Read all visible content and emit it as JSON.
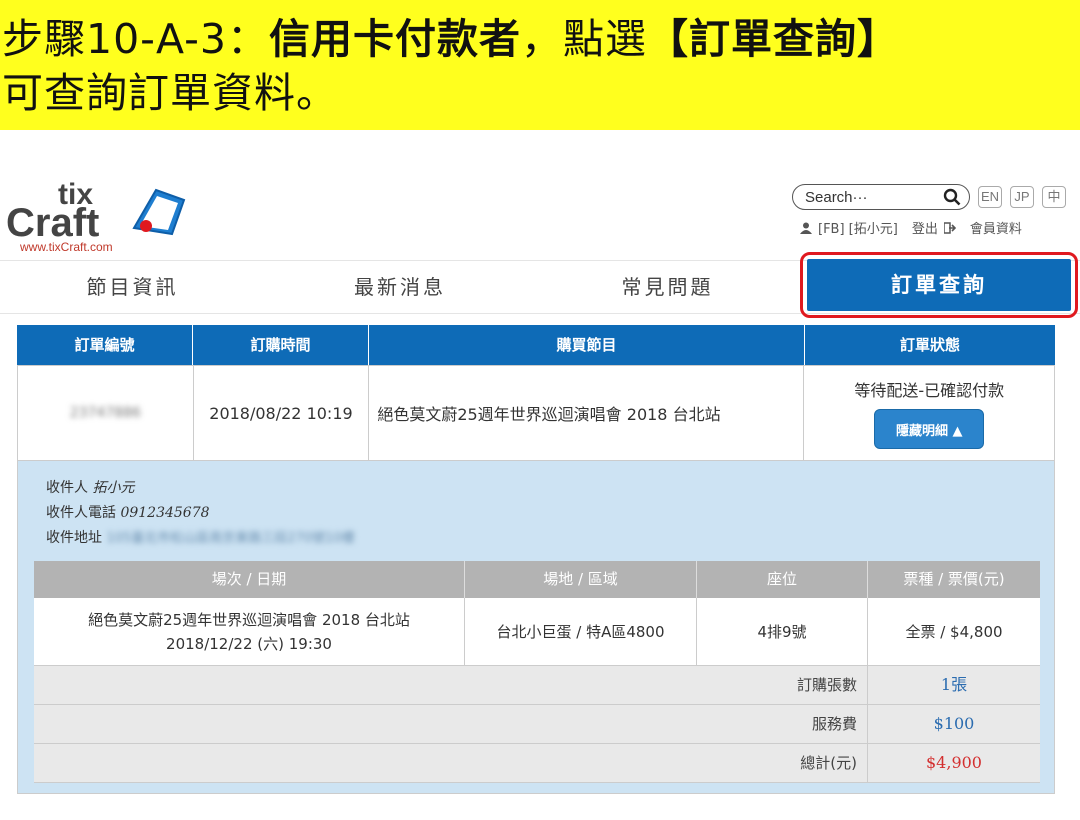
{
  "banner": {
    "line1_prefix": "步驟10-A-3：",
    "line1_bold": "信用卡付款者",
    "line1_mid": "，點選",
    "line1_bold2": "【訂單查詢】",
    "line2": "可查詢訂單資料。"
  },
  "header": {
    "logo_top": "tix",
    "logo_bottom": "Craft",
    "logo_url": "www.tixCraft.com",
    "search_placeholder": "Search···",
    "lang": [
      "EN",
      "JP",
      "中"
    ],
    "user": "[FB] [拓小元]",
    "logout": "登出",
    "member": "會員資料"
  },
  "nav": {
    "items": [
      "節目資訊",
      "最新消息",
      "常見問題"
    ],
    "active": "訂單查詢"
  },
  "order_table": {
    "headers": [
      "訂單編號",
      "訂購時間",
      "購買節目",
      "訂單狀態"
    ],
    "order_no": "23747886",
    "time": "2018/08/22 10:19",
    "event": "絕色莫文蔚25週年世界巡迴演唱會 2018 台北站",
    "status": "等待配送-已確認付款",
    "hide_btn": "隱藏明細 ▲"
  },
  "recipient": {
    "name_label": "收件人",
    "name": "拓小元",
    "phone_label": "收件人電話",
    "phone": "0912345678",
    "addr_label": "收件地址",
    "addr": "105臺北市松山區南京東路三段270號10樓"
  },
  "detail_table": {
    "headers": [
      "場次 / 日期",
      "場地 / 區域",
      "座位",
      "票種 / 票價(元)"
    ],
    "row": {
      "event": "絕色莫文蔚25週年世界巡迴演唱會 2018 台北站",
      "date": "2018/12/22 (六) 19:30",
      "venue": "台北小巨蛋 / 特A區4800",
      "seat": "4排9號",
      "ticket": "全票 / $4,800"
    },
    "summary": [
      {
        "label": "訂購張數",
        "value": "1張"
      },
      {
        "label": "服務費",
        "value": "$100"
      },
      {
        "label": "總計(元)",
        "value": "$4,900"
      }
    ]
  },
  "colors": {
    "banner": "#ffff1e",
    "primary": "#0e6bb7",
    "highlight_border": "#e0191f",
    "sum_blue": "#2b6cb0",
    "sum_red": "#d32f2f"
  }
}
